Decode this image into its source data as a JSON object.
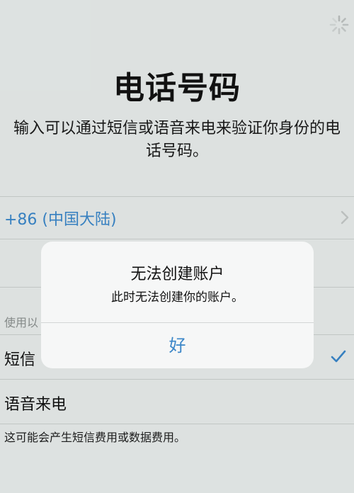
{
  "page": {
    "title": "电话号码",
    "subtitle": "输入可以通过短信或语音来电来验证你身份的电话号码。"
  },
  "country": {
    "label": "+86 (中国大陆)"
  },
  "verification": {
    "section_label": "使用以",
    "options": [
      "短信",
      "语音来电"
    ],
    "selected": "短信"
  },
  "footnote": "这可能会产生短信费用或数据费用。",
  "alert": {
    "title": "无法创建账户",
    "message": "此时无法创建你的账户。",
    "button_label": "好"
  },
  "colors": {
    "accent": "#3a86c8",
    "background": "#e6ebea",
    "alert_background": "#f6f7f7"
  },
  "icons": {
    "spinner": "activity-spinner-icon",
    "chevron": "chevron-right-icon",
    "check": "checkmark-icon"
  }
}
